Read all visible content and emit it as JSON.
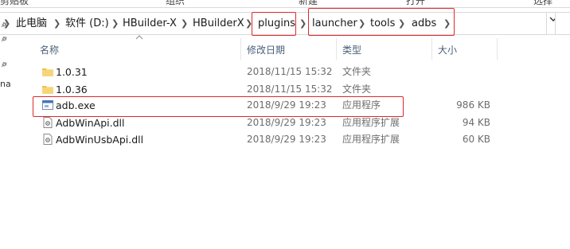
{
  "ribbon": {
    "groups": [
      "剪贴板",
      "组织",
      "新建",
      "打开",
      "选择"
    ]
  },
  "address": {
    "crumbs": [
      "此电脑",
      "软件 (D:)",
      "HBuilder-X",
      "HBuilderX",
      "plugins",
      "launcher",
      "tools",
      "adbs"
    ]
  },
  "nav": {
    "label": "na"
  },
  "columns": {
    "name": "名称",
    "date": "修改日期",
    "type": "类型",
    "size": "大小"
  },
  "files": [
    {
      "name": "1.0.31",
      "date": "2018/11/15 15:32",
      "type": "文件夹",
      "size": "",
      "icon": "folder-icon"
    },
    {
      "name": "1.0.36",
      "date": "2018/11/15 15:32",
      "type": "文件夹",
      "size": "",
      "icon": "folder-icon"
    },
    {
      "name": "adb.exe",
      "date": "2018/9/29 19:23",
      "type": "应用程序",
      "size": "986 KB",
      "icon": "application-icon"
    },
    {
      "name": "AdbWinApi.dll",
      "date": "2018/9/29 19:23",
      "type": "应用程序扩展",
      "size": "94 KB",
      "icon": "dll-file-icon"
    },
    {
      "name": "AdbWinUsbApi.dll",
      "date": "2018/9/29 19:23",
      "type": "应用程序扩展",
      "size": "60 KB",
      "icon": "dll-file-icon"
    }
  ],
  "colors": {
    "highlight": "#e0282b",
    "folder": "#f0c24f",
    "header_text": "#4c607a"
  }
}
